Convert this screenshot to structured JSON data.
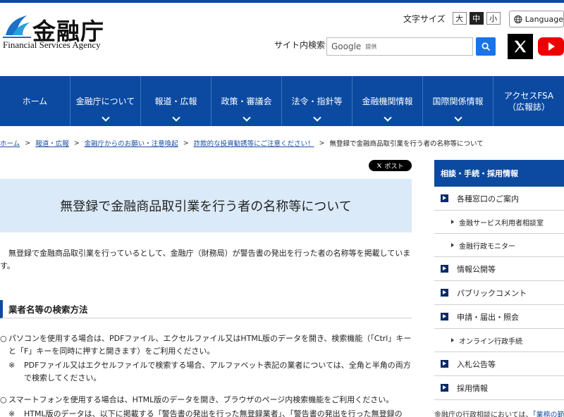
{
  "header": {
    "logo_jp": "金融庁",
    "logo_en": "Financial Services Agency",
    "fontsize_label": "文字サイズ",
    "fontsize_options": [
      "大",
      "中",
      "小"
    ],
    "fontsize_selected": "中",
    "language_label": "Language",
    "search_label": "サイト内検索",
    "search_google": "Google",
    "search_provided": "提供"
  },
  "nav": {
    "items": [
      {
        "label": "ホーム",
        "chevron": false
      },
      {
        "label": "金融庁について",
        "chevron": true
      },
      {
        "label": "報道・広報",
        "chevron": true
      },
      {
        "label": "政策・審議会",
        "chevron": true
      },
      {
        "label": "法令・指針等",
        "chevron": true
      },
      {
        "label": "金融機関情報",
        "chevron": true
      },
      {
        "label": "国際関係情報",
        "chevron": true
      },
      {
        "label": "アクセスFSA（広報誌）",
        "chevron": false
      }
    ]
  },
  "breadcrumb": {
    "links": [
      "ホーム",
      "報道・広報",
      "金融庁からのお願い・注意喚起",
      "詐欺的な投資勧誘等にご注意ください！"
    ],
    "current": "無登録で金融商品取引業を行う者の名称等について"
  },
  "main": {
    "post_label": "ポスト",
    "title": "無登録で金融商品取引業を行う者の名称等について",
    "intro": "無登録で金融商品取引業を行っているとして、金融庁（財務局）が警告書の発出を行った者の名称等を掲載しています。",
    "section_title": "業者名等の検索方法",
    "bullet1": "パソコンを使用する場合は、PDFファイル、エクセルファイル又はHTML版のデータを開き、検索機能（「Ctrl」キーと「F」キーを同時に押すと開きます）をご利用ください。",
    "note1": "PDFファイル又はエクセルファイルで検索する場合、アルファベット表記の業者については、全角と半角の両方で検索してください。",
    "bullet2": "スマートフォンを使用する場合は、HTML版のデータを開き、ブラウザのページ内検索機能をご利用ください。",
    "note2": "HTML版のデータは、以下に掲載する「警告書の発出を行った無登録業者」、「警告書の発出を行った無登録の",
    "bullet_mark": "○",
    "note_mark": "※"
  },
  "sidebar": {
    "heading": "相談・手続・採用情報",
    "items": [
      {
        "label": "各種窓口のご案内",
        "level": 1
      },
      {
        "label": "金融サービス利用者相談室",
        "level": 2
      },
      {
        "label": "金融行政モニター",
        "level": 2
      },
      {
        "label": "情報公開等",
        "level": 1
      },
      {
        "label": "パブリックコメント",
        "level": 1
      },
      {
        "label": "申請・届出・照会",
        "level": 1
      },
      {
        "label": "オンライン行政手続",
        "level": 2
      },
      {
        "label": "入札公告等",
        "level": 1
      },
      {
        "label": "採用情報",
        "level": 1
      }
    ],
    "footer_text": "金融庁の行政相談においては、",
    "footer_link": "「業務の範"
  }
}
